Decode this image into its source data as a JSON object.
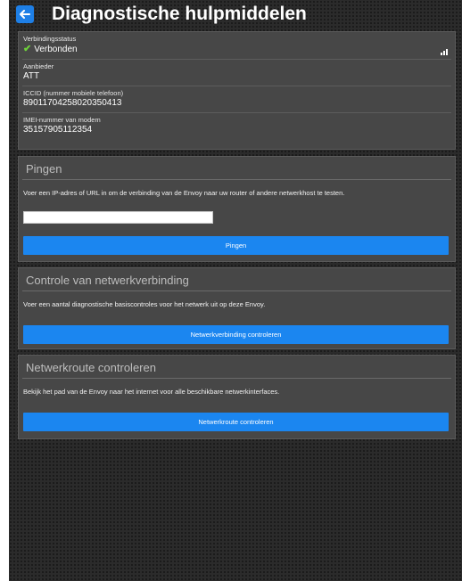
{
  "header": {
    "title": "Diagnostische hulpmiddelen"
  },
  "info": [
    {
      "label": "Verbindingsstatus",
      "value": "Verbonden"
    },
    {
      "label": "Aanbieder",
      "value": "ATT"
    },
    {
      "label": "ICCID (nummer mobiele telefoon)",
      "value": "89011704258020350413"
    },
    {
      "label": "IMEI-nummer van modem",
      "value": "35157905112354"
    }
  ],
  "ping": {
    "title": "Pingen",
    "description": "Voer een IP-adres of URL in om de verbinding van de Envoy naar uw router of andere netwerkhost te testen.",
    "input_value": "",
    "button": "Pingen"
  },
  "network_check": {
    "title": "Controle van netwerkverbinding",
    "description": "Voer een aantal diagnostische basiscontroles voor het netwerk uit op deze Envoy.",
    "button": "Netwerkverbinding controleren"
  },
  "route_check": {
    "title": "Netwerkroute controleren",
    "description": "Bekijk het pad van de Envoy naar het internet voor alle beschikbare netwerkinterfaces.",
    "button": "Netwerkroute controleren"
  },
  "icons": {
    "back": "back-arrow-icon",
    "status": "checkmark-icon",
    "signal": "signal-strength-icon"
  },
  "colors": {
    "accent": "#1b86f0",
    "status_ok": "#6ed13a",
    "panel": "#474747"
  }
}
